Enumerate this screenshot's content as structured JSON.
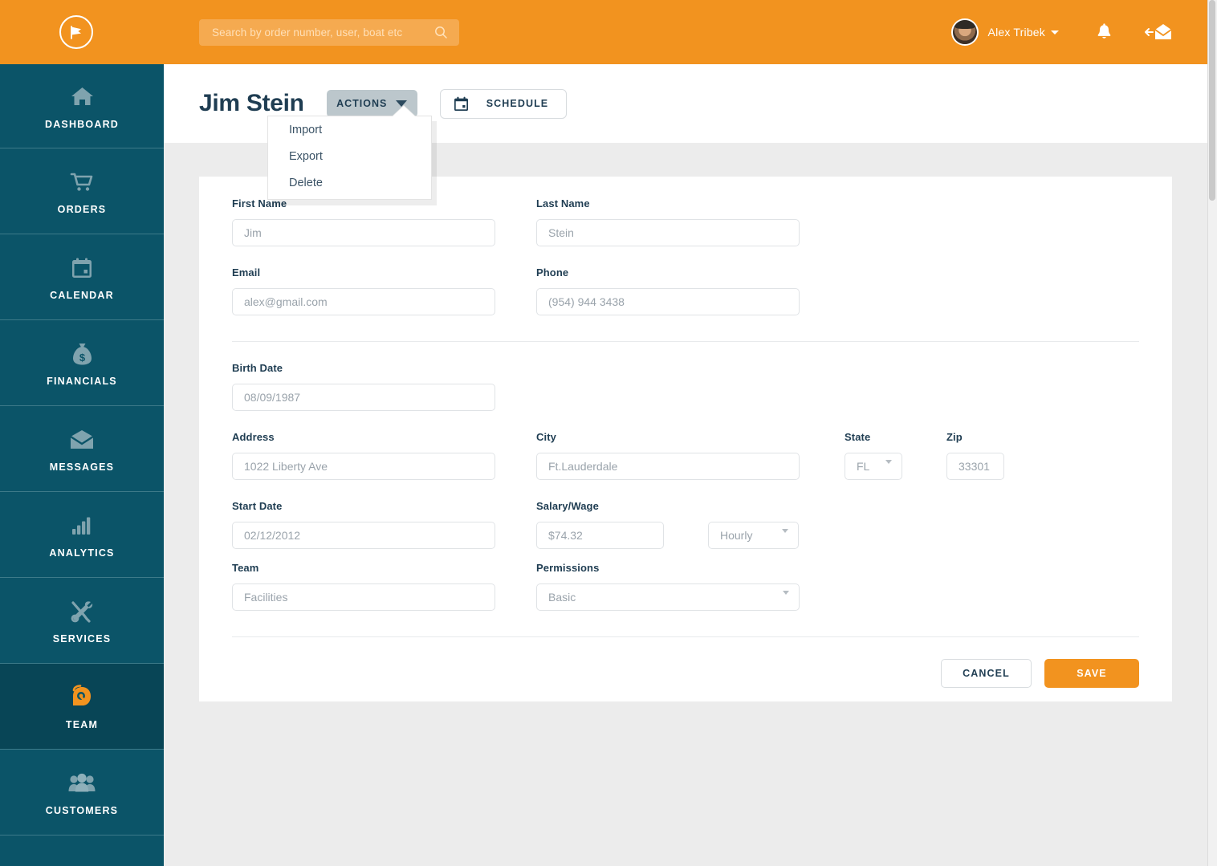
{
  "header": {
    "logo_icon": "megaphone-icon",
    "search": {
      "placeholder": "Search by order number, user, boat etc",
      "value": "",
      "icon": "search-icon"
    },
    "user_name": "Alex Tribek",
    "notifications_icon": "bell-icon",
    "logout_icon": "logout-envelope-icon"
  },
  "sidebar": {
    "items": [
      {
        "label": "DASHBOARD",
        "icon": "home-icon",
        "active": false
      },
      {
        "label": "ORDERS",
        "icon": "cart-icon",
        "active": false
      },
      {
        "label": "CALENDAR",
        "icon": "calendar-icon",
        "active": false
      },
      {
        "label": "FINANCIALS",
        "icon": "money-bag-icon",
        "active": false
      },
      {
        "label": "MESSAGES",
        "icon": "envelope-icon",
        "active": false
      },
      {
        "label": "ANALYTICS",
        "icon": "bar-chart-icon",
        "active": false
      },
      {
        "label": "SERVICES",
        "icon": "tools-icon",
        "active": false
      },
      {
        "label": "TEAM",
        "icon": "headset-agent-icon",
        "active": true
      },
      {
        "label": "CUSTOMERS",
        "icon": "people-icon",
        "active": false
      }
    ]
  },
  "page": {
    "title": "Jim Stein",
    "actions_button": "ACTIONS",
    "schedule_button": "SCHEDULE",
    "schedule_icon": "calendar-icon",
    "actions_menu": [
      "Import",
      "Export",
      "Delete"
    ]
  },
  "form": {
    "first_name": {
      "label": "First Name",
      "value": "Jim"
    },
    "last_name": {
      "label": "Last Name",
      "value": "Stein"
    },
    "email": {
      "label": "Email",
      "value": "alex@gmail.com"
    },
    "phone": {
      "label": "Phone",
      "value": "(954) 944 3438"
    },
    "birth_date": {
      "label": "Birth Date",
      "value": "08/09/1987"
    },
    "address": {
      "label": "Address",
      "value": "1022 Liberty Ave"
    },
    "city": {
      "label": "City",
      "value": "Ft.Lauderdale"
    },
    "state": {
      "label": "State",
      "value": "FL"
    },
    "zip": {
      "label": "Zip",
      "value": "33301"
    },
    "start_date": {
      "label": "Start Date",
      "value": "02/12/2012"
    },
    "salary": {
      "label": "Salary/Wage",
      "value": "$74.32"
    },
    "salary_type": {
      "value": "Hourly"
    },
    "team": {
      "label": "Team",
      "value": "Facilities"
    },
    "permissions": {
      "label": "Permissions",
      "value": "Basic"
    }
  },
  "footer": {
    "cancel_label": "CANCEL",
    "save_label": "SAVE"
  },
  "colors": {
    "brand_orange": "#f2931f",
    "sidebar_teal": "#0b5468",
    "sidebar_active": "#084556",
    "text_dark": "#1f3d52",
    "actions_gray": "#bcc7cc"
  }
}
